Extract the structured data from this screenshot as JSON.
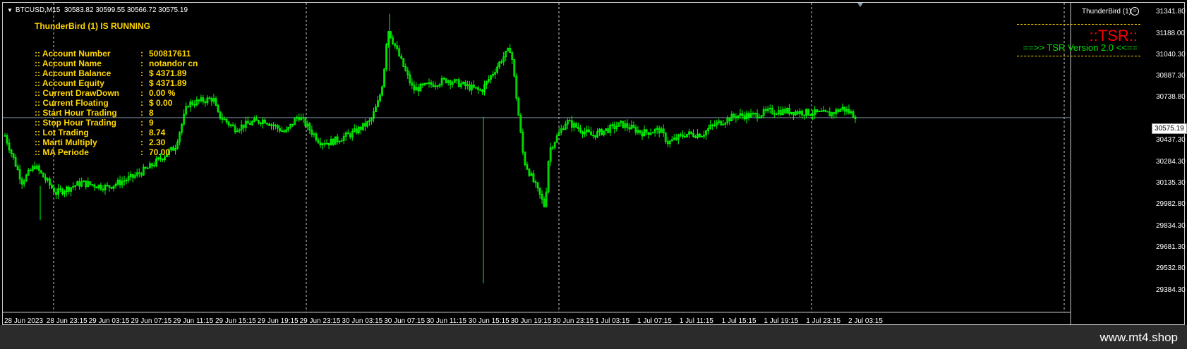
{
  "symbol_header": {
    "symbol": "BTCUSD,M15",
    "ohlc": "30583.82 30599.55 30566.72 30575.19"
  },
  "ea": {
    "status": "ThunderBird (1) IS RUNNING",
    "name": "ThunderBird (1)",
    "smiley_icon": "smiley-icon"
  },
  "account_info": [
    {
      "label": ":: Account Number",
      "value": "500817611"
    },
    {
      "label": ":: Account Name",
      "value": "notandor cn"
    },
    {
      "label": ":: Account Balance",
      "value": "$ 4371.89"
    },
    {
      "label": ":: Account Equity",
      "value": "$ 4371.89"
    },
    {
      "label": ":: Current DrawDown",
      "value": "0.00 %"
    },
    {
      "label": ":: Current Floating",
      "value": "$ 0.00"
    },
    {
      "label": ":: Start Hour Trading",
      "value": "8"
    },
    {
      "label": ":: Stop Hour Trading",
      "value": "9"
    },
    {
      "label": ":: Lot Trading",
      "value": "8.74"
    },
    {
      "label": ":: Marti Multiply",
      "value": "2.30"
    },
    {
      "label": ":: MA Periode",
      "value": "70.00"
    }
  ],
  "tsr": {
    "title": "::TSR::",
    "version": "==>>  TSR Version 2.0  <<=="
  },
  "price_axis": [
    "31341.80",
    "31188.00",
    "31040.30",
    "30887.30",
    "30738.80",
    "30437.30",
    "30284.30",
    "30135.30",
    "29982.80",
    "29834.30",
    "29681.30",
    "29532.80",
    "29384.30"
  ],
  "current_price": "30575.19",
  "time_axis": [
    "28 Jun 2023",
    "28 Jun 23:15",
    "29 Jun 03:15",
    "29 Jun 07:15",
    "29 Jun 11:15",
    "29 Jun 15:15",
    "29 Jun 19:15",
    "29 Jun 23:15",
    "30 Jun 03:15",
    "30 Jun 07:15",
    "30 Jun 11:15",
    "30 Jun 15:15",
    "30 Jun 19:15",
    "30 Jun 23:15",
    "1 Jul 03:15",
    "1 Jul 07:15",
    "1 Jul 11:15",
    "1 Jul 15:15",
    "1 Jul 19:15",
    "1 Jul 23:15",
    "2 Jul 03:15"
  ],
  "footer": {
    "site": "www.mt4.shop"
  },
  "colors": {
    "candle": "#00ff00",
    "info_text": "#ffd700",
    "tsr_title": "#ff0000",
    "tsr_version": "#00e000",
    "price_line": "#778899"
  },
  "chart_data": {
    "type": "candlestick",
    "symbol": "BTCUSD",
    "timeframe": "M15",
    "ylim": [
      29384.3,
      31341.8
    ],
    "last_close": 30575.19,
    "series": [
      {
        "name": "BTCUSD,M15",
        "path_x": [
          0,
          0.02,
          0.035,
          0.06,
          0.09,
          0.12,
          0.15,
          0.17,
          0.2,
          0.215,
          0.245,
          0.25,
          0.27,
          0.29,
          0.305,
          0.33,
          0.345,
          0.37,
          0.38,
          0.39,
          0.41,
          0.43,
          0.44,
          0.445,
          0.45,
          0.48,
          0.52,
          0.56,
          0.585,
          0.595,
          0.61,
          0.63,
          0.635,
          0.64,
          0.66,
          0.69,
          0.725,
          0.75,
          0.77,
          0.78,
          0.8,
          0.82,
          0.83,
          0.84,
          0.86,
          0.88,
          0.9,
          0.92,
          0.945,
          0.97,
          0.985,
          1.0
        ],
        "path_y": [
          30450,
          30130,
          30240,
          30050,
          30120,
          30090,
          30160,
          30230,
          30370,
          30670,
          30710,
          30600,
          30500,
          30540,
          30560,
          30470,
          30590,
          30410,
          30400,
          30420,
          30470,
          30550,
          30700,
          30850,
          31200,
          30770,
          30840,
          30760,
          30990,
          31060,
          30280,
          30020,
          29950,
          30350,
          30550,
          30450,
          30530,
          30470,
          30490,
          30400,
          30460,
          30460,
          30510,
          30540,
          30590,
          30590,
          30620,
          30620,
          30610,
          30600,
          30640,
          30590
        ]
      }
    ]
  }
}
